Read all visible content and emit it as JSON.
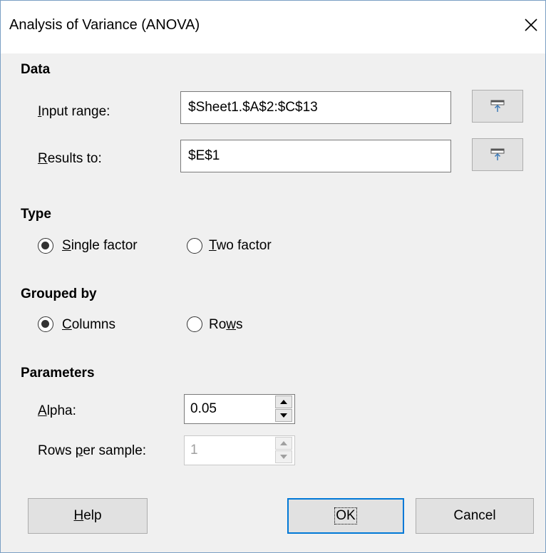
{
  "window": {
    "title": "Analysis of Variance (ANOVA)",
    "close_icon": "close-icon"
  },
  "data_section": {
    "heading": "Data",
    "input_range": {
      "label_accel": "I",
      "label_rest": "nput range:",
      "value": "$Sheet1.$A$2:$C$13",
      "shrink_icon": "shrink-icon"
    },
    "results_to": {
      "label_accel": "R",
      "label_rest": "esults to:",
      "value": "$E$1",
      "shrink_icon": "shrink-icon"
    }
  },
  "type_section": {
    "heading": "Type",
    "options": [
      {
        "label_accel": "S",
        "label_rest": "ingle factor",
        "selected": true
      },
      {
        "label_accel": "T",
        "label_rest": "wo factor",
        "selected": false
      }
    ]
  },
  "grouped_section": {
    "heading": "Grouped by",
    "options": [
      {
        "label_accel": "C",
        "label_rest": "olumns",
        "selected": true
      },
      {
        "label_pre": "Ro",
        "label_accel": "w",
        "label_rest": "s",
        "selected": false
      }
    ]
  },
  "parameters_section": {
    "heading": "Parameters",
    "alpha": {
      "label_accel": "A",
      "label_rest": "lpha:",
      "value": "0.05"
    },
    "rows_per_sample": {
      "label_pre": "Rows ",
      "label_accel": "p",
      "label_rest": "er sample:",
      "value": "1",
      "enabled": false
    }
  },
  "buttons": {
    "help": {
      "label_accel": "H",
      "label_rest": "elp"
    },
    "ok": {
      "label": "OK"
    },
    "cancel": {
      "label": "Cancel"
    }
  },
  "colors": {
    "accent": "#0078d7",
    "dialog_bg": "#f0f0f0",
    "title_bg": "#ffffff"
  }
}
